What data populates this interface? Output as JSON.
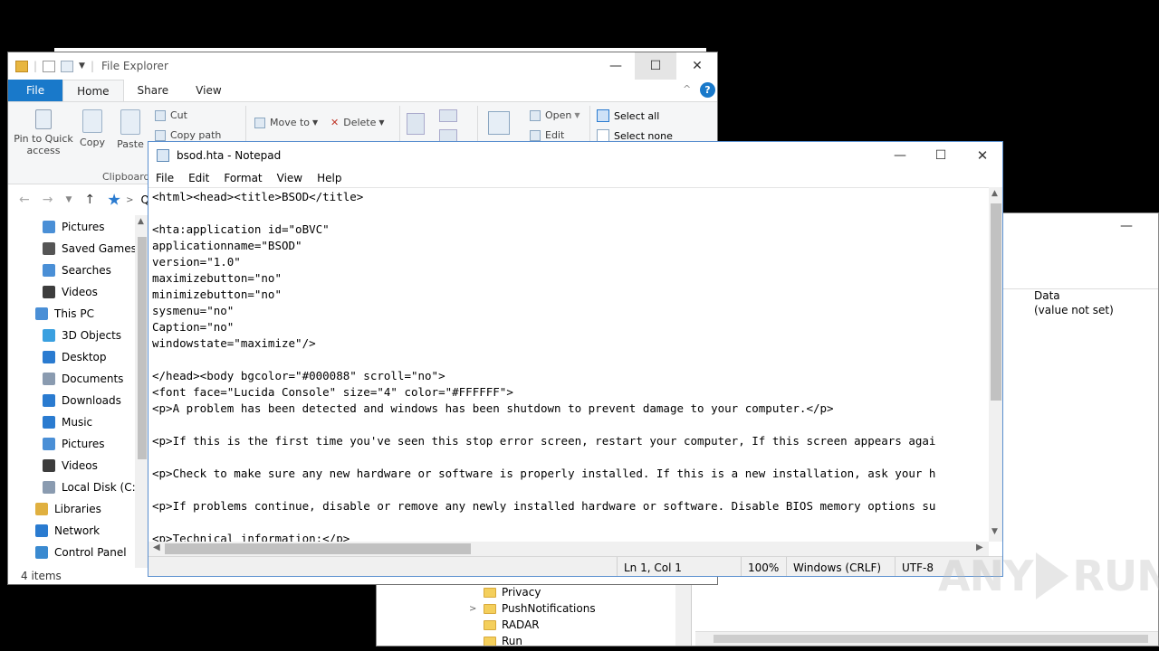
{
  "regedit": {
    "minimize_glyph": "—",
    "column_data": "Data",
    "value_not_set": "(value not set)",
    "tree_items": [
      "Privacy",
      "PushNotifications",
      "RADAR",
      "Run"
    ]
  },
  "explorer": {
    "title": "File Explorer",
    "tabs": [
      "File",
      "Home",
      "Share",
      "View"
    ],
    "ribbon": {
      "pin": "Pin to Quick access",
      "copy": "Copy",
      "paste": "Paste",
      "cut": "Cut",
      "copy_path": "Copy path",
      "clipboard": "Clipboard",
      "move_to": "Move to",
      "delete": "Delete",
      "open": "Open",
      "edit": "Edit",
      "select_all": "Select all",
      "select_none": "Select none"
    },
    "address_fragment": "Q",
    "nav_items": [
      {
        "label": "Pictures",
        "color": "#4a8fd6"
      },
      {
        "label": "Saved Games",
        "color": "#555555"
      },
      {
        "label": "Searches",
        "color": "#4a8fd6"
      },
      {
        "label": "Videos",
        "color": "#3d3d3d"
      },
      {
        "label": "This PC",
        "color": "#4a8fd6"
      },
      {
        "label": "3D Objects",
        "color": "#3aa0e0"
      },
      {
        "label": "Desktop",
        "color": "#2a7bd0"
      },
      {
        "label": "Documents",
        "color": "#8a9bb0"
      },
      {
        "label": "Downloads",
        "color": "#2a7bd0"
      },
      {
        "label": "Music",
        "color": "#2a7bd0"
      },
      {
        "label": "Pictures",
        "color": "#4a8fd6"
      },
      {
        "label": "Videos",
        "color": "#3d3d3d"
      },
      {
        "label": "Local Disk (C:)",
        "color": "#8a9bb0"
      },
      {
        "label": "Libraries",
        "color": "#e0b040"
      },
      {
        "label": "Network",
        "color": "#2a7bd0"
      },
      {
        "label": "Control Panel",
        "color": "#3a8ad0"
      }
    ],
    "status": "4 items",
    "help": "?",
    "up_chevron": "^"
  },
  "notepad": {
    "title": "bsod.hta - Notepad",
    "menus": [
      "File",
      "Edit",
      "Format",
      "View",
      "Help"
    ],
    "content": "<html><head><title>BSOD</title>\n\n<hta:application id=\"oBVC\"\napplicationname=\"BSOD\"\nversion=\"1.0\"\nmaximizebutton=\"no\"\nminimizebutton=\"no\"\nsysmenu=\"no\"\nCaption=\"no\"\nwindowstate=\"maximize\"/>\n\n</head><body bgcolor=\"#000088\" scroll=\"no\">\n<font face=\"Lucida Console\" size=\"4\" color=\"#FFFFFF\">\n<p>A problem has been detected and windows has been shutdown to prevent damage to your computer.</p>\n\n<p>If this is the first time you've seen this stop error screen, restart your computer, If this screen appears agai\n\n<p>Check to make sure any new hardware or software is properly installed. If this is a new installation, ask your h\n\n<p>If problems continue, disable or remove any newly installed hardware or software. Disable BIOS memory options su\n\n<p>Technical information:</p>",
    "status": {
      "position": "Ln 1, Col 1",
      "zoom": "100%",
      "line_ending": "Windows (CRLF)",
      "encoding": "UTF-8"
    }
  },
  "window_controls": {
    "minimize": "—",
    "maximize": "☐",
    "close": "✕"
  },
  "watermark": {
    "left": "ANY",
    "right": "RUN"
  }
}
